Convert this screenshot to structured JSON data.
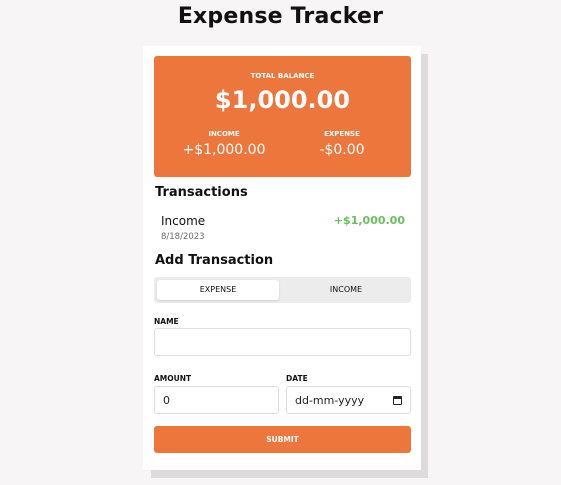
{
  "app": {
    "title": "Expense Tracker"
  },
  "balance": {
    "label": "TOTAL BALANCE",
    "amount": "$1,000.00",
    "income_label": "INCOME",
    "income_value": "+$1,000.00",
    "expense_label": "EXPENSE",
    "expense_value": "-$0.00"
  },
  "transactions": {
    "title": "Transactions",
    "items": [
      {
        "name": "Income",
        "date": "8/18/2023",
        "amount": "+$1,000.00"
      }
    ]
  },
  "add_transaction": {
    "title": "Add Transaction",
    "tabs": [
      "EXPENSE",
      "INCOME"
    ],
    "selected_tab": "EXPENSE",
    "name_label": "NAME",
    "name_value": "",
    "amount_label": "AMOUNT",
    "amount_value": "0",
    "date_label": "DATE",
    "date_placeholder": "dd-mm-yyyy",
    "submit_label": "SUBMIT"
  },
  "colors": {
    "accent": "#ec763b",
    "income_green": "#69c05b",
    "background": "#f7f5f5"
  }
}
